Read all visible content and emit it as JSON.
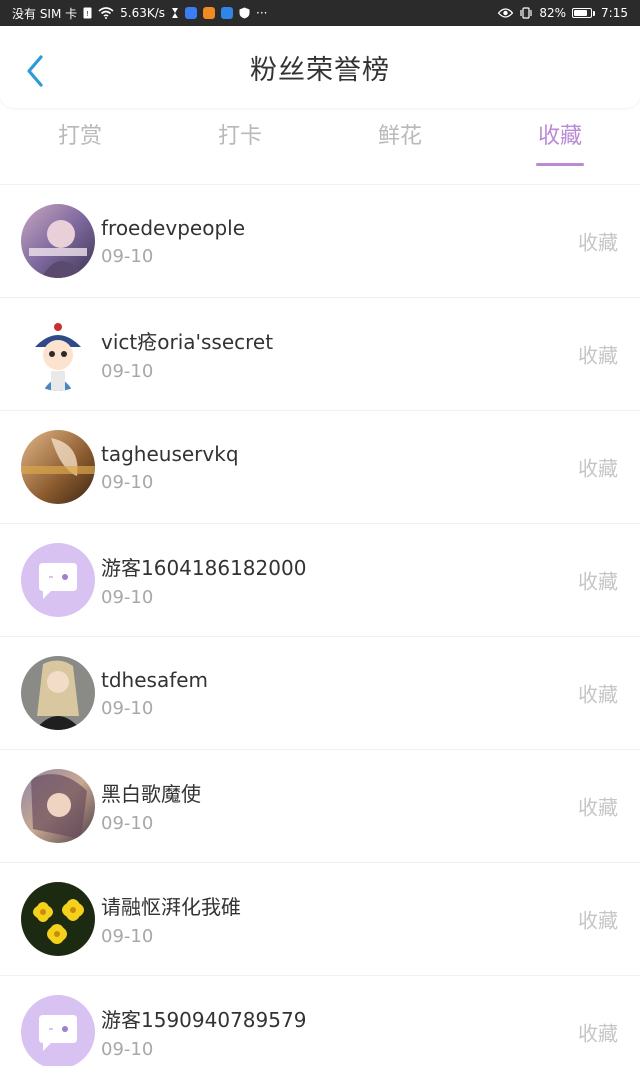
{
  "status_bar": {
    "carrier": "没有 SIM 卡",
    "net_speed": "5.63K/s",
    "battery": "82%",
    "time": "7:15",
    "battery_level": 0.82
  },
  "header": {
    "title": "粉丝荣誉榜",
    "back_icon": "chevron-left-icon",
    "accent_color": "#2d9bd8"
  },
  "tabs": [
    {
      "label": "打赏",
      "active": false
    },
    {
      "label": "打卡",
      "active": false
    },
    {
      "label": "鲜花",
      "active": false
    },
    {
      "label": "收藏",
      "active": true
    }
  ],
  "theme": {
    "active_tab_color": "#b98bd6"
  },
  "list": [
    {
      "name": "froedevpeople",
      "date": "09-10",
      "action": "收藏",
      "avatar": "photo-avatar"
    },
    {
      "name": "vict疮oria'ssecret",
      "date": "09-10",
      "action": "收藏",
      "avatar": "cartoon-avatar"
    },
    {
      "name": "tagheuservkq",
      "date": "09-10",
      "action": "收藏",
      "avatar": "photo-avatar"
    },
    {
      "name": "游客1604186182000",
      "date": "09-10",
      "action": "收藏",
      "avatar": "default-chat-avatar"
    },
    {
      "name": "tdhesafem",
      "date": "09-10",
      "action": "收藏",
      "avatar": "photo-avatar"
    },
    {
      "name": "黑白歌魔使",
      "date": "09-10",
      "action": "收藏",
      "avatar": "photo-avatar"
    },
    {
      "name": "请融怄湃化我碓",
      "date": "09-10",
      "action": "收藏",
      "avatar": "flower-avatar"
    },
    {
      "name": "游客1590940789579",
      "date": "09-10",
      "action": "收藏",
      "avatar": "default-chat-avatar"
    }
  ]
}
